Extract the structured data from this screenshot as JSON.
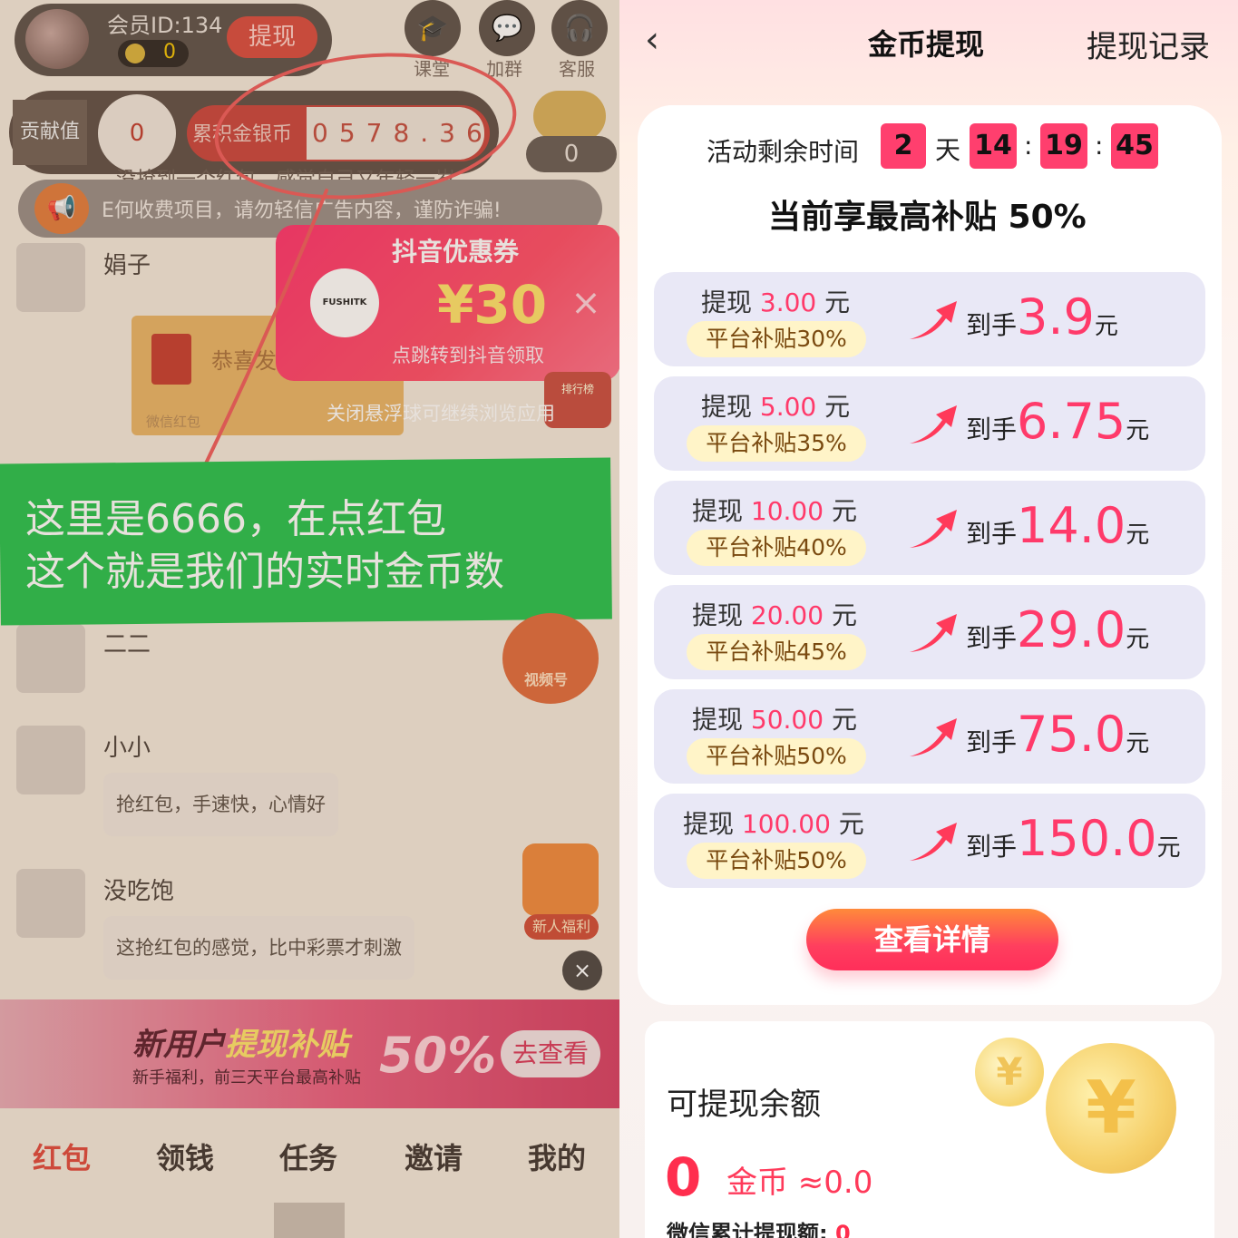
{
  "left": {
    "member_id": "会员ID:134",
    "coin_count": "0",
    "withdraw_button": "提现",
    "top_icons": [
      {
        "icon": "graduation-cap-icon",
        "label": "课堂"
      },
      {
        "icon": "chat-group-icon",
        "label": "加群"
      },
      {
        "icon": "headset-icon",
        "label": "客服"
      }
    ],
    "contribution_label": "贡献值",
    "contribution_value": "0",
    "accum_gold_label": "累积金银币",
    "accum_gold_value": "0578.36",
    "piggy_value": "0",
    "marquee_top": "没抢到一个红包，感觉自己又年轻一岁",
    "marquee_text": "E何收费项目，请勿轻信广告内容，谨防诈骗!",
    "chats": [
      {
        "name": "娟子",
        "bubble": ""
      },
      {
        "name": "二二",
        "bubble": ""
      },
      {
        "name": "小小",
        "bubble": "抢红包，手速快，心情好"
      },
      {
        "name": "没吃饱",
        "bubble": "这抢红包的感觉，比中彩票才刺激"
      }
    ],
    "redpacket_title": "恭喜发",
    "redpacket_footer": "微信红包",
    "coupon": {
      "title": "抖音优惠券",
      "logo_text": "FUSHITK",
      "amount": "¥30",
      "subtitle": "点跳转到抖音领取",
      "close_hint": "关闭悬浮球可继续浏览应用"
    },
    "rank_label": "排行榜",
    "annotation": {
      "line1": "这里是6666，在点红包",
      "line2": "这个就是我们的实时金币数"
    },
    "video_label": "视频号",
    "newbie_label": "新人福利",
    "banner": {
      "title_a": "新用户",
      "title_b": "提现补贴",
      "subtitle": "新手福利，前三天平台最高补贴",
      "percent": "50%",
      "button": "去查看"
    },
    "nav": [
      "红包",
      "领钱",
      "任务",
      "邀请",
      "我的"
    ]
  },
  "right": {
    "title": "金币提现",
    "history": "提现记录",
    "timer_label": "活动剩余时间",
    "timer": {
      "days": "2",
      "day_unit": "天",
      "hours": "14",
      "minutes": "19",
      "seconds": "45"
    },
    "subsidy_title": "当前享最高补贴 50%",
    "tiers": [
      {
        "prefix": "提现 ",
        "amount": "3.00",
        "suffix": " 元",
        "badge": "平台补贴30%",
        "get_prefix": "到手",
        "get_value": "3.9",
        "get_unit": "元"
      },
      {
        "prefix": "提现 ",
        "amount": "5.00",
        "suffix": " 元",
        "badge": "平台补贴35%",
        "get_prefix": "到手",
        "get_value": "6.75",
        "get_unit": "元"
      },
      {
        "prefix": "提现 ",
        "amount": "10.00",
        "suffix": " 元",
        "badge": "平台补贴40%",
        "get_prefix": "到手",
        "get_value": "14.0",
        "get_unit": "元"
      },
      {
        "prefix": "提现 ",
        "amount": "20.00",
        "suffix": " 元",
        "badge": "平台补贴45%",
        "get_prefix": "到手",
        "get_value": "29.0",
        "get_unit": "元"
      },
      {
        "prefix": "提现 ",
        "amount": "50.00",
        "suffix": " 元",
        "badge": "平台补贴50%",
        "get_prefix": "到手",
        "get_value": "75.0",
        "get_unit": "元"
      },
      {
        "prefix": "提现 ",
        "amount": "100.00",
        "suffix": " 元",
        "badge": "平台补贴50%",
        "get_prefix": "到手",
        "get_value": "150.0",
        "get_unit": "元"
      }
    ],
    "detail_button": "查看详情",
    "balance_title": "可提现余额",
    "balance_amount": "0",
    "balance_unit": "金币 ≈0.0",
    "wechat_total_label": "微信累计提现额: ",
    "wechat_total_value": "0",
    "coin_symbol": "¥",
    "colors": {
      "accent": "#ff3a6a",
      "tier_bg": "#e9e8f6",
      "badge_bg": "#fff4c8",
      "green_note": "#22c14b"
    }
  }
}
